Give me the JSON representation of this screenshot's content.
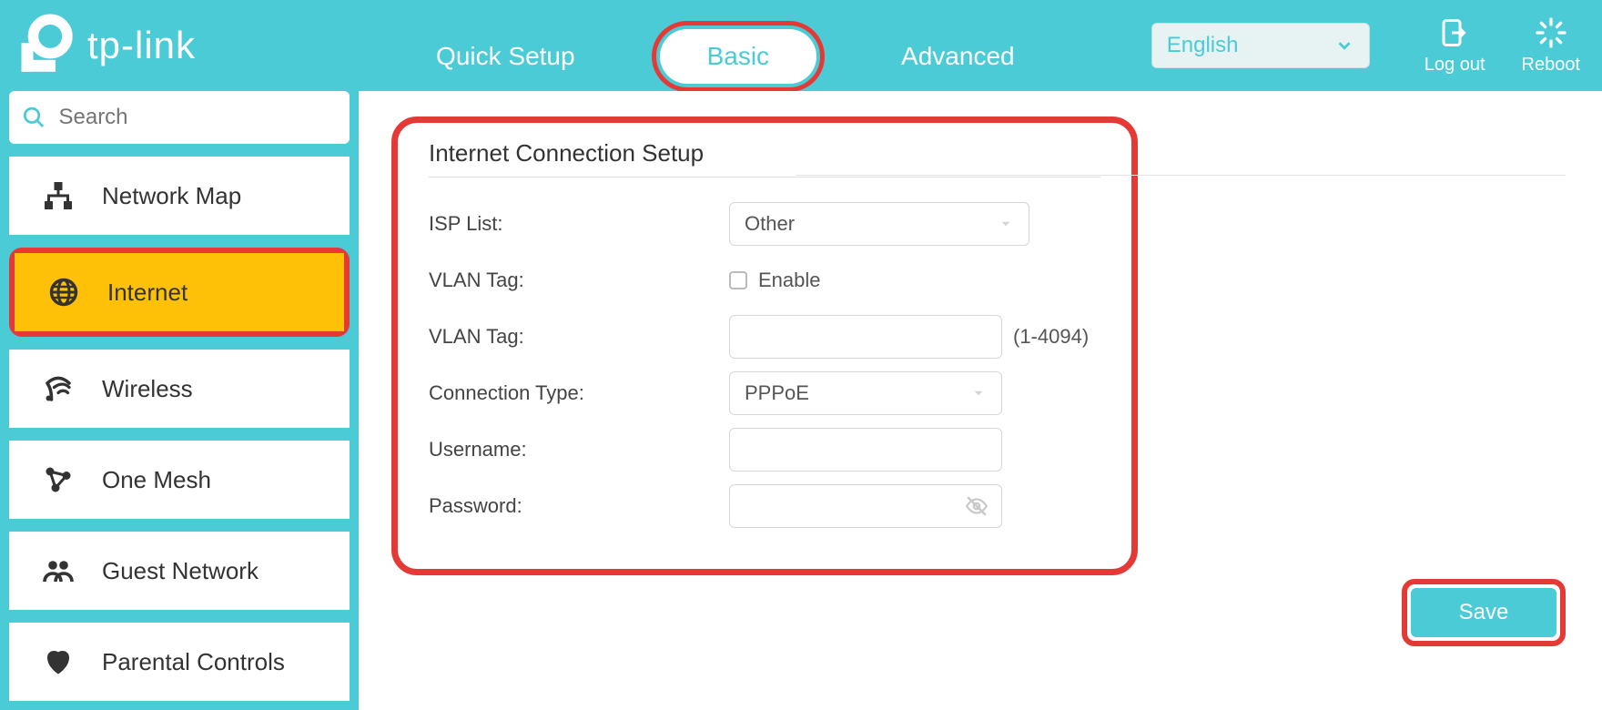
{
  "brand": "tp-link",
  "tabs": {
    "quick_setup": "Quick Setup",
    "basic": "Basic",
    "advanced": "Advanced",
    "active": "basic"
  },
  "language": {
    "selected": "English"
  },
  "header_actions": {
    "logout": "Log out",
    "reboot": "Reboot"
  },
  "search": {
    "placeholder": "Search"
  },
  "sidebar": {
    "items": [
      {
        "id": "network-map",
        "label": "Network Map"
      },
      {
        "id": "internet",
        "label": "Internet"
      },
      {
        "id": "wireless",
        "label": "Wireless"
      },
      {
        "id": "one-mesh",
        "label": "One Mesh"
      },
      {
        "id": "guest-network",
        "label": "Guest Network"
      },
      {
        "id": "parental-controls",
        "label": "Parental Controls"
      }
    ],
    "active": "internet"
  },
  "panel": {
    "title": "Internet Connection Setup",
    "isp_list": {
      "label": "ISP List:",
      "value": "Other"
    },
    "vlan_enable": {
      "label": "VLAN Tag:",
      "checkbox_label": "Enable",
      "checked": false
    },
    "vlan_tag": {
      "label": "VLAN Tag:",
      "value": "",
      "hint": "(1-4094)"
    },
    "connection_type": {
      "label": "Connection Type:",
      "value": "PPPoE"
    },
    "username": {
      "label": "Username:",
      "value": ""
    },
    "password": {
      "label": "Password:",
      "value": ""
    }
  },
  "save_button": "Save"
}
